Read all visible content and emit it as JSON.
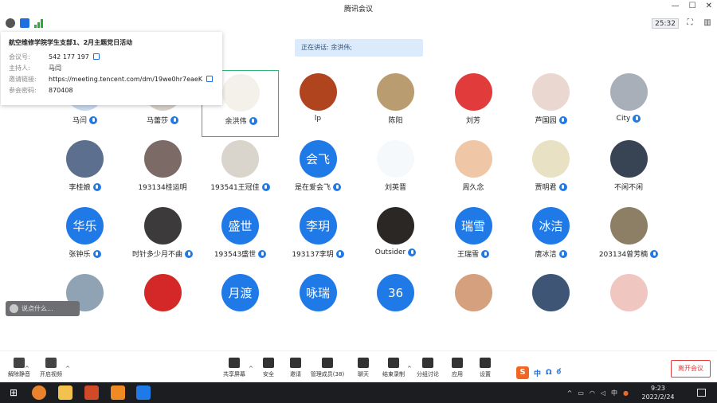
{
  "window": {
    "title": "腾讯会议",
    "min": "—",
    "max": "☐",
    "close": "✕"
  },
  "status": {
    "timer": "25:32"
  },
  "info_panel": {
    "title": "航空维修学院学生支部1、2月主题党日活动",
    "rows": [
      {
        "label": "会议号:",
        "value": "542 177 197"
      },
      {
        "label": "主持人:",
        "value": "马闫"
      },
      {
        "label": "邀请链接:",
        "value": "https://meeting.tencent.com/dm/19we0hr7eaeK"
      },
      {
        "label": "参会密码:",
        "value": "870408"
      }
    ]
  },
  "speaking": "正在讲话: 余洪伟;",
  "participants": [
    {
      "name": "马闫",
      "avatar": "img",
      "color": "#c9d9ee",
      "mic": true
    },
    {
      "name": "马蕾莎",
      "avatar": "img",
      "color": "#d8d0c8",
      "mic": true
    },
    {
      "name": "余洪伟",
      "avatar": "img",
      "color": "#f4f0ea",
      "mic": true,
      "active": true
    },
    {
      "name": "lp",
      "avatar": "img",
      "color": "#b0441e",
      "mic": false
    },
    {
      "name": "陈阳",
      "avatar": "img",
      "color": "#b99c70",
      "mic": false
    },
    {
      "name": "刘芳",
      "avatar": "img",
      "color": "#e23b3b",
      "mic": false
    },
    {
      "name": "芦国园",
      "avatar": "img",
      "color": "#e9d7d0",
      "mic": true
    },
    {
      "name": "City",
      "avatar": "img",
      "color": "#a8afb8",
      "mic": true
    },
    {
      "name": "李桂娘",
      "avatar": "img",
      "color": "#5c6f8e",
      "mic": true
    },
    {
      "name": "193134桂运明",
      "avatar": "img",
      "color": "#7b6a66",
      "mic": false
    },
    {
      "name": "193541王冠佳",
      "avatar": "img",
      "color": "#d9d4cc",
      "mic": true
    },
    {
      "name": "是在爱会飞",
      "avatar": "text",
      "text": "会飞",
      "mic": true
    },
    {
      "name": "刘英晋",
      "avatar": "img",
      "color": "#f5f9fc",
      "mic": false
    },
    {
      "name": "周久念",
      "avatar": "img",
      "color": "#efc7a6",
      "mic": false
    },
    {
      "name": "贾明君",
      "avatar": "img",
      "color": "#e8e1c4",
      "mic": true
    },
    {
      "name": "不闲不闲",
      "avatar": "img",
      "color": "#384454",
      "mic": false
    },
    {
      "name": "张钟乐",
      "avatar": "text",
      "text": "华乐",
      "mic": true
    },
    {
      "name": "时针多少月不曲",
      "avatar": "img",
      "color": "#3d3a3c",
      "mic": true
    },
    {
      "name": "193543盛世",
      "avatar": "text",
      "text": "盛世",
      "mic": true
    },
    {
      "name": "193137李玥",
      "avatar": "text",
      "text": "李玥",
      "mic": true
    },
    {
      "name": "Outsider",
      "avatar": "img",
      "color": "#2b2725",
      "mic": true
    },
    {
      "name": "王瑞雪",
      "avatar": "text",
      "text": "瑞雪",
      "mic": true
    },
    {
      "name": "唐冰洁",
      "avatar": "text",
      "text": "冰洁",
      "mic": true
    },
    {
      "name": "203134曾芳楠",
      "avatar": "img",
      "color": "#8c7f66",
      "mic": true
    },
    {
      "name": "",
      "avatar": "img",
      "color": "#8fa3b5",
      "mic": false
    },
    {
      "name": "",
      "avatar": "img",
      "color": "#d42828",
      "mic": false
    },
    {
      "name": "",
      "avatar": "text",
      "text": "月渡",
      "mic": false
    },
    {
      "name": "",
      "avatar": "text",
      "text": "咏瑞",
      "mic": false
    },
    {
      "name": "",
      "avatar": "num",
      "text": "36",
      "mic": false
    },
    {
      "name": "",
      "avatar": "img",
      "color": "#d4a07e",
      "mic": false
    },
    {
      "name": "",
      "avatar": "img",
      "color": "#3e5576",
      "mic": false
    },
    {
      "name": "",
      "avatar": "img",
      "color": "#f0c6c0",
      "mic": false
    }
  ],
  "reaction": {
    "label": "说点什么..."
  },
  "toolbar": [
    {
      "label": "解除静音",
      "icon": "mic-off-icon"
    },
    {
      "label": "开启视频",
      "icon": "camera-off-icon"
    },
    {
      "label": "共享屏幕",
      "icon": "share-screen-icon"
    },
    {
      "label": "安全",
      "icon": "shield-icon"
    },
    {
      "label": "邀请",
      "icon": "invite-icon"
    },
    {
      "label": "管理成员(38)",
      "icon": "members-icon"
    },
    {
      "label": "聊天",
      "icon": "chat-icon"
    },
    {
      "label": "结束录制",
      "icon": "record-icon"
    },
    {
      "label": "分组讨论",
      "icon": "breakout-icon"
    },
    {
      "label": "应用",
      "icon": "apps-icon"
    },
    {
      "label": "设置",
      "icon": "settings-icon"
    }
  ],
  "ime": {
    "s": "S",
    "zh": "中",
    "b": "Ω",
    "c": "ఠ"
  },
  "leave": "离开会议",
  "taskbar": {
    "lang": "中",
    "time": "9:23",
    "date": "2022/2/24"
  },
  "colors": {
    "accent": "#1f7ae8",
    "active_border": "#2eb872",
    "leave_red": "#e23c3c"
  }
}
